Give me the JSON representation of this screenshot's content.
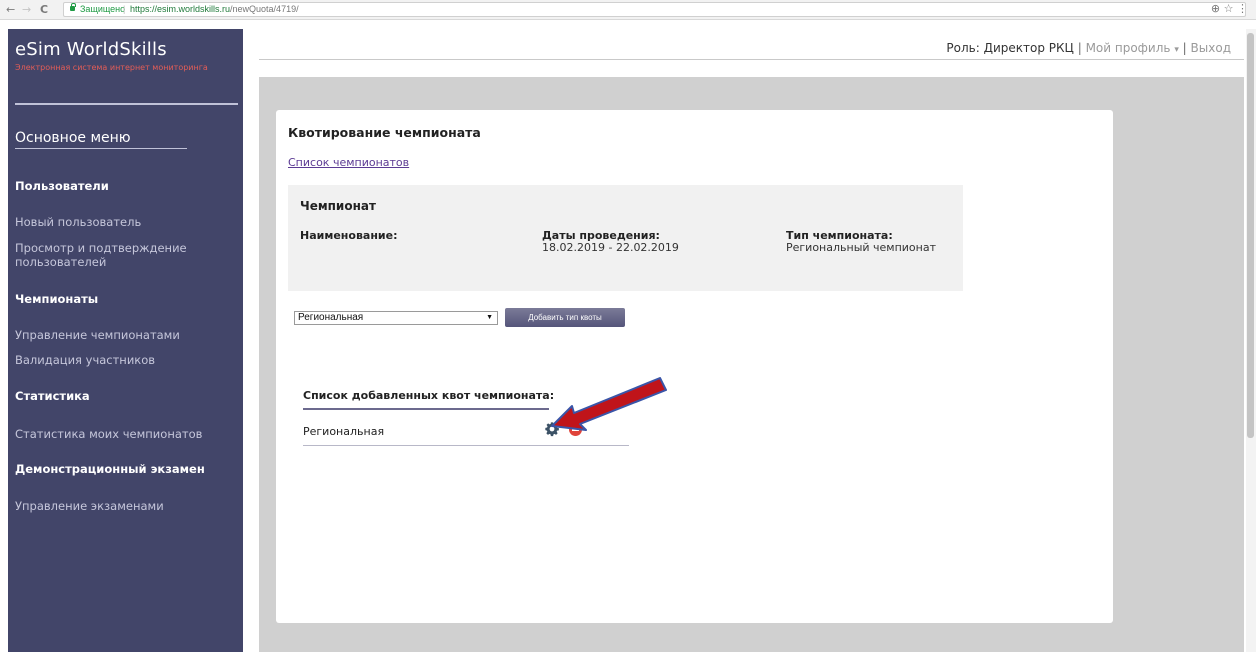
{
  "browser": {
    "back": "←",
    "forward": "→",
    "reload": "C",
    "secure_label": "Защищено",
    "url_base": "https://esim.worldskills.ru",
    "url_path": "/newQuota/4719/",
    "zoom_icon": "⊕",
    "star_icon": "☆",
    "menu_icon": "⋮"
  },
  "sidebar": {
    "brand": "eSim WorldSkills",
    "subtitle": "Электронная система интернет мониторинга",
    "main_menu": "Основное меню",
    "sections": [
      {
        "title": "Пользователи",
        "items": [
          "Новый пользователь",
          "Просмотр и подтверждение пользователей"
        ]
      },
      {
        "title": "Чемпионаты",
        "items": [
          "Управление чемпионатами",
          "Валидация участников"
        ]
      },
      {
        "title": "Статистика",
        "items": [
          "Статистика моих чемпионатов"
        ]
      },
      {
        "title": "Демонстрационный экзамен",
        "items": [
          "Управление экзаменами"
        ]
      }
    ]
  },
  "header": {
    "role": "Роль: Директор РКЦ",
    "separator": "|",
    "profile": "Мой профиль",
    "profile_caret": "▾",
    "logout": "Выход"
  },
  "main": {
    "title": "Квотирование чемпионата",
    "back_link": "Список чемпионатов",
    "panel": {
      "title": "Чемпионат",
      "name_label": "Наименование:",
      "name_value": "",
      "dates_label": "Даты проведения:",
      "dates_value": "18.02.2019 - 22.02.2019",
      "type_label": "Тип чемпионата:",
      "type_value": "Региональный чемпионат"
    },
    "quota_select": {
      "selected": "Региональная",
      "arrow": "▼"
    },
    "add_button": "Добавить тип квоты",
    "list": {
      "title": "Список добавленных квот чемпионата:",
      "rows": [
        {
          "name": "Региональная"
        }
      ]
    }
  },
  "colors": {
    "sidebar_bg": "#424569",
    "subtitle": "#e35d57",
    "content_bg": "#d0d0d0",
    "button": "#5f5f83",
    "delete": "#e0443a",
    "annotation_arrow": "#c0141a"
  },
  "icons": {
    "row_settings": "gear-icon",
    "row_delete": "remove-icon",
    "annotation": "red-arrow-annotation"
  }
}
